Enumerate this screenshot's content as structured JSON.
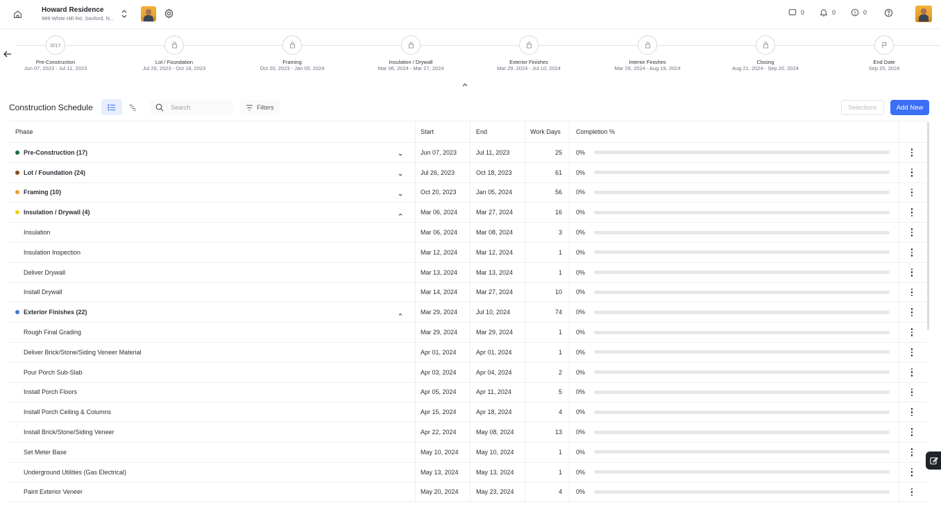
{
  "project": {
    "name": "Howard Residence",
    "address": "989 White Hill Rd, Sanford, N..."
  },
  "header_counters": [
    {
      "icon": "chat-icon",
      "count": "0"
    },
    {
      "icon": "bell-icon",
      "count": "0"
    },
    {
      "icon": "info-icon",
      "count": "0"
    }
  ],
  "timeline": {
    "milestones": [
      {
        "name": "Pre-Construction",
        "dates": "Jun 07, 2023 - Jul 11, 2023",
        "badge": "0/17",
        "icon": "progress-badge"
      },
      {
        "name": "Lot / Foundation",
        "dates": "Jul 26, 2023 - Oct 18, 2023",
        "badge": "",
        "icon": "lock-icon"
      },
      {
        "name": "Framing",
        "dates": "Oct 20, 2023 - Jan 05, 2024",
        "badge": "",
        "icon": "lock-icon"
      },
      {
        "name": "Insulation / Drywall",
        "dates": "Mar 06, 2024 - Mar 27, 2024",
        "badge": "",
        "icon": "lock-icon"
      },
      {
        "name": "Exterior Finishes",
        "dates": "Mar 29, 2024 - Jul 10, 2024",
        "badge": "",
        "icon": "lock-icon"
      },
      {
        "name": "Interior Finishes",
        "dates": "Mar 29, 2024 - Aug 19, 2024",
        "badge": "",
        "icon": "lock-icon"
      },
      {
        "name": "Closing",
        "dates": "Aug 21, 2024 - Sep 20, 2024",
        "badge": "",
        "icon": "lock-icon"
      },
      {
        "name": "End Date",
        "dates": "Sep 20, 2024",
        "badge": "",
        "icon": "flag-icon"
      }
    ]
  },
  "toolbar": {
    "title": "Construction Schedule",
    "search_placeholder": "Search",
    "filters_label": "Filters",
    "selections_label": "Selections",
    "add_new_label": "Add New"
  },
  "table": {
    "columns": {
      "phase": "Phase",
      "start": "Start",
      "end": "End",
      "work_days": "Work Days",
      "completion": "Completion %"
    },
    "rows": [
      {
        "type": "group",
        "name": "Pre-Construction (17)",
        "color": "#1e6b3a",
        "expanded": false,
        "start": "Jun 07, 2023",
        "end": "Jul 11, 2023",
        "days": "25",
        "pct": "0%",
        "progress": 0
      },
      {
        "type": "group",
        "name": "Lot / Foundation (24)",
        "color": "#8a4a1c",
        "expanded": false,
        "start": "Jul 26, 2023",
        "end": "Oct 18, 2023",
        "days": "61",
        "pct": "0%",
        "progress": 0
      },
      {
        "type": "group",
        "name": "Framing (10)",
        "color": "#f0992e",
        "expanded": false,
        "start": "Oct 20, 2023",
        "end": "Jan 05, 2024",
        "days": "56",
        "pct": "0%",
        "progress": 0
      },
      {
        "type": "group",
        "name": "Insulation / Drywall (4)",
        "color": "#f2d21d",
        "expanded": true,
        "start": "Mar 06, 2024",
        "end": "Mar 27, 2024",
        "days": "16",
        "pct": "0%",
        "progress": 0
      },
      {
        "type": "child",
        "name": "Insulation",
        "start": "Mar 06, 2024",
        "end": "Mar 08, 2024",
        "days": "3",
        "pct": "0%",
        "progress": 0
      },
      {
        "type": "child",
        "name": "Insulation Inspection",
        "start": "Mar 12, 2024",
        "end": "Mar 12, 2024",
        "days": "1",
        "pct": "0%",
        "progress": 0
      },
      {
        "type": "child",
        "name": "Deliver Drywall",
        "start": "Mar 13, 2024",
        "end": "Mar 13, 2024",
        "days": "1",
        "pct": "0%",
        "progress": 0
      },
      {
        "type": "child",
        "name": "Install Drywall",
        "start": "Mar 14, 2024",
        "end": "Mar 27, 2024",
        "days": "10",
        "pct": "0%",
        "progress": 0
      },
      {
        "type": "group",
        "name": "Exterior Finishes (22)",
        "color": "#3f78e0",
        "expanded": true,
        "start": "Mar 29, 2024",
        "end": "Jul 10, 2024",
        "days": "74",
        "pct": "0%",
        "progress": 0
      },
      {
        "type": "child",
        "name": "Rough Final Grading",
        "start": "Mar 29, 2024",
        "end": "Mar 29, 2024",
        "days": "1",
        "pct": "0%",
        "progress": 0
      },
      {
        "type": "child",
        "name": "Deliver Brick/Stone/Siding Veneer Material",
        "start": "Apr 01, 2024",
        "end": "Apr 01, 2024",
        "days": "1",
        "pct": "0%",
        "progress": 0
      },
      {
        "type": "child",
        "name": "Pour Porch Sub-Slab",
        "start": "Apr 03, 2024",
        "end": "Apr 04, 2024",
        "days": "2",
        "pct": "0%",
        "progress": 0
      },
      {
        "type": "child",
        "name": "Install Porch Floors",
        "start": "Apr 05, 2024",
        "end": "Apr 11, 2024",
        "days": "5",
        "pct": "0%",
        "progress": 0
      },
      {
        "type": "child",
        "name": "Install Porch Ceiling & Columns",
        "start": "Apr 15, 2024",
        "end": "Apr 18, 2024",
        "days": "4",
        "pct": "0%",
        "progress": 0
      },
      {
        "type": "child",
        "name": "Install Brick/Stone/Siding Veneer",
        "start": "Apr 22, 2024",
        "end": "May 08, 2024",
        "days": "13",
        "pct": "0%",
        "progress": 0
      },
      {
        "type": "child",
        "name": "Set Meter Base",
        "start": "May 10, 2024",
        "end": "May 10, 2024",
        "days": "1",
        "pct": "0%",
        "progress": 0
      },
      {
        "type": "child",
        "name": "Underground Utilities (Gas Electrical)",
        "start": "May 13, 2024",
        "end": "May 13, 2024",
        "days": "1",
        "pct": "0%",
        "progress": 0
      },
      {
        "type": "child",
        "name": "Paint Exterior Veneer",
        "start": "May 20, 2024",
        "end": "May 23, 2024",
        "days": "4",
        "pct": "0%",
        "progress": 0
      }
    ]
  }
}
